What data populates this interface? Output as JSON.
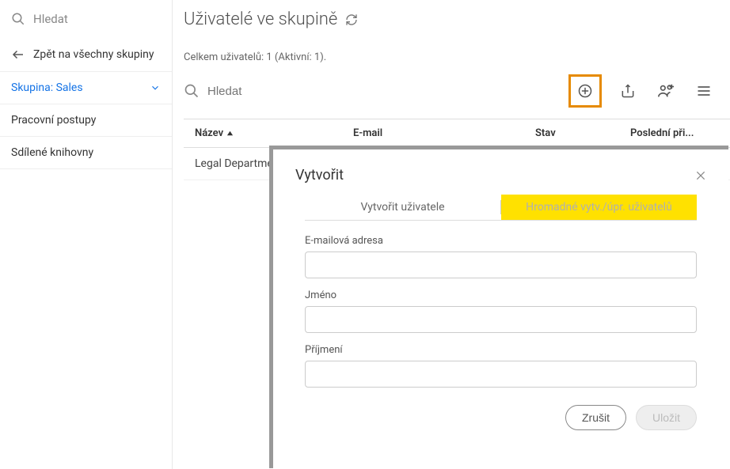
{
  "sidebar": {
    "search_placeholder": "Hledat",
    "back_label": "Zpět na všechny skupiny",
    "group_label": "Skupina: Sales",
    "items": [
      {
        "label": "Pracovní postupy"
      },
      {
        "label": "Sdílené knihovny"
      }
    ]
  },
  "header": {
    "title": "Uživatelé ve skupině"
  },
  "summary": {
    "text": "Celkem uživatelů: 1 (Aktivní: 1)."
  },
  "toolbar": {
    "search_placeholder": "Hledat"
  },
  "table": {
    "headers": {
      "name": "Název",
      "email": "E-mail",
      "status": "Stav",
      "last_login": "Poslední při..."
    },
    "rows": [
      {
        "name": "Legal Department"
      }
    ]
  },
  "modal": {
    "title": "Vytvořit",
    "tabs": {
      "create_user": "Vytvořit uživatele",
      "bulk": "Hromadné vytv./úpr. uživatelů"
    },
    "fields": {
      "email_label": "E-mailová adresa",
      "first_name_label": "Jméno",
      "last_name_label": "Příjmení"
    },
    "buttons": {
      "cancel": "Zrušit",
      "save": "Uložit"
    }
  }
}
